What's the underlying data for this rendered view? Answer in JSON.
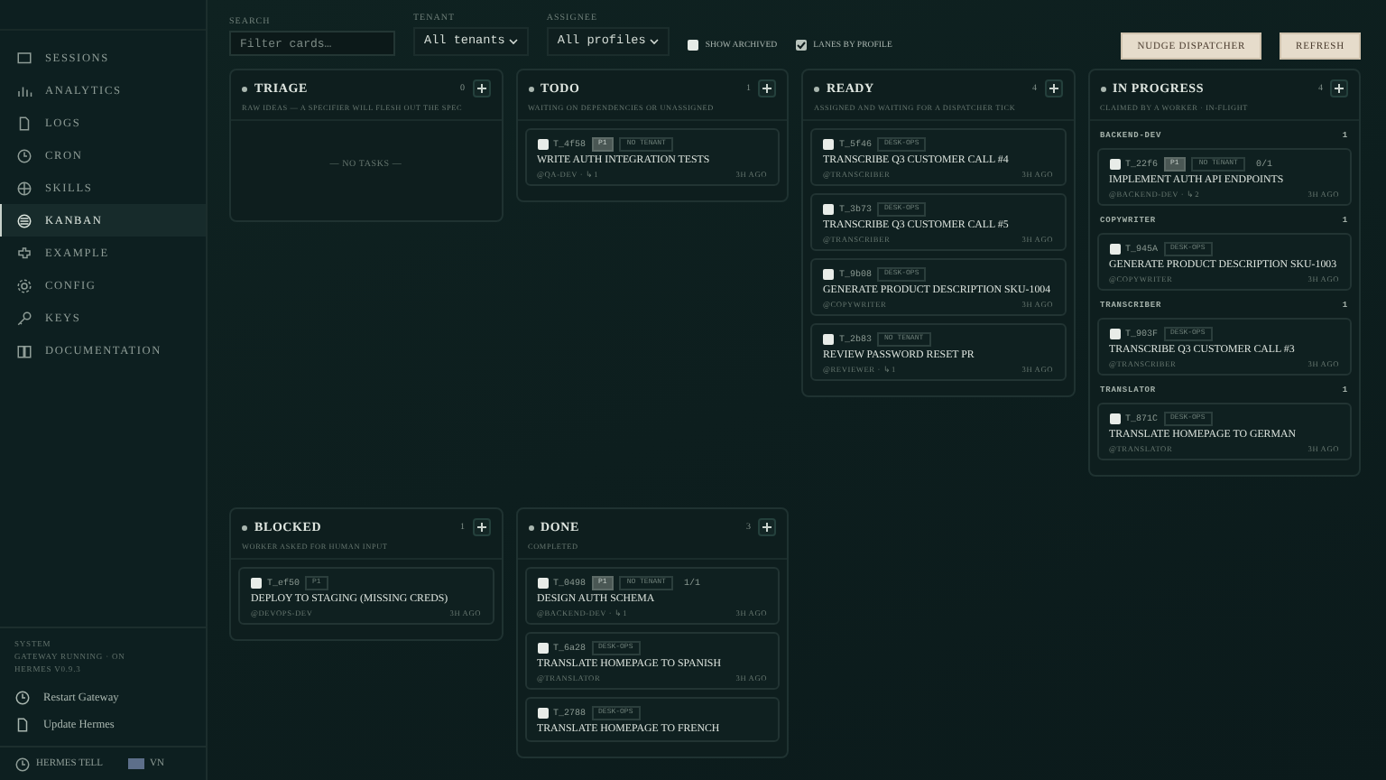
{
  "sidebar": {
    "items": [
      {
        "label": "SESSIONS",
        "selected": false
      },
      {
        "label": "ANALYTICS",
        "selected": false
      },
      {
        "label": "LOGS",
        "selected": false
      },
      {
        "label": "CRON",
        "selected": false
      },
      {
        "label": "SKILLS",
        "selected": false
      },
      {
        "label": "KANBAN",
        "selected": true
      },
      {
        "label": "EXAMPLE",
        "selected": false
      },
      {
        "label": "CONFIG",
        "selected": false
      },
      {
        "label": "KEYS",
        "selected": false
      },
      {
        "label": "DOCUMENTATION",
        "selected": false
      }
    ],
    "system": {
      "title": "SYSTEM",
      "lines": [
        "GATEWAY RUNNING · ON",
        "HERMES V0.9.3"
      ]
    },
    "actions": [
      "Restart Gateway",
      "Update Hermes"
    ],
    "footer": {
      "name": "HERMES TELL",
      "lang": "VN"
    }
  },
  "toolbar": {
    "search": {
      "label": "SEARCH",
      "placeholder": "Filter cards…"
    },
    "tenant": {
      "label": "TENANT",
      "value": "All tenants"
    },
    "assignee": {
      "label": "ASSIGNEE",
      "value": "All profiles"
    },
    "toggles": [
      {
        "label": "SHOW ARCHIVED",
        "checked": false
      },
      {
        "label": "LANES BY PROFILE",
        "checked": true
      }
    ],
    "buttons": [
      "NUDGE DISPATCHER",
      "REFRESH"
    ]
  },
  "columns": [
    {
      "title": "TRIAGE",
      "count": "0",
      "description": "RAW IDEAS — A SPECIFIER WILL FLESH OUT THE SPEC",
      "empty": "— NO TASKS —"
    },
    {
      "title": "TODO",
      "count": "1",
      "description": "WAITING ON DEPENDENCIES OR UNASSIGNED",
      "cards": [
        {
          "id": "T_4f58",
          "tags": [
            {
              "text": "P1",
              "kind": "priority"
            },
            {
              "text": "NO TENANT",
              "kind": "tenant"
            }
          ],
          "title": "WRITE AUTH INTEGRATION TESTS",
          "meta": "@QA-DEV · ↳ 1",
          "time": "3H AGO",
          "selected": false
        }
      ]
    },
    {
      "title": "READY",
      "count": "4",
      "description": "ASSIGNED AND WAITING FOR A DISPATCHER TICK",
      "cards": [
        {
          "id": "T_5f46",
          "tags": [
            {
              "text": "DESK-OPS",
              "kind": "tenant"
            }
          ],
          "title": "TRANSCRIBE Q3 CUSTOMER CALL #4",
          "meta": "@TRANSCRIBER",
          "time": "3H AGO",
          "selected": false
        },
        {
          "id": "T_3b73",
          "tags": [
            {
              "text": "DESK-OPS",
              "kind": "tenant"
            }
          ],
          "title": "TRANSCRIBE Q3 CUSTOMER CALL #5",
          "meta": "@TRANSCRIBER",
          "time": "3H AGO",
          "selected": false
        },
        {
          "id": "T_9b08",
          "tags": [
            {
              "text": "DESK-OPS",
              "kind": "tenant"
            }
          ],
          "title": "GENERATE PRODUCT DESCRIPTION SKU-1004",
          "meta": "@COPYWRITER",
          "time": "3H AGO",
          "selected": false
        },
        {
          "id": "T_2b83",
          "tags": [
            {
              "text": "NO TENANT",
              "kind": "tenant"
            }
          ],
          "title": "REVIEW PASSWORD RESET PR",
          "meta": "@REVIEWER · ↳ 1",
          "time": "3H AGO",
          "selected": false
        }
      ]
    },
    {
      "title": "IN PROGRESS",
      "count": "4",
      "description": "CLAIMED BY A WORKER · IN-FLIGHT",
      "lanes": [
        {
          "name": "BACKEND-DEV",
          "count": "1",
          "cards": [
            {
              "id": "T_22f6",
              "tags": [
                {
                  "text": "P1",
                  "kind": "priority"
                },
                {
                  "text": "NO TENANT",
                  "kind": "tenant"
                },
                {
                  "text": "0/1",
                  "kind": "progress"
                }
              ],
              "title": "IMPLEMENT AUTH API ENDPOINTS",
              "meta": "@BACKEND-DEV · ↳ 2",
              "time": "3H AGO",
              "selected": false
            }
          ]
        },
        {
          "name": "COPYWRITER",
          "count": "1",
          "cards": [
            {
              "id": "T_945A",
              "tags": [
                {
                  "text": "DESK-OPS",
                  "kind": "tenant"
                }
              ],
              "title": "GENERATE PRODUCT DESCRIPTION SKU-1003",
              "meta": "@COPYWRITER",
              "time": "3H AGO",
              "selected": false
            }
          ]
        },
        {
          "name": "TRANSCRIBER",
          "count": "1",
          "cards": [
            {
              "id": "T_903F",
              "tags": [
                {
                  "text": "DESK-OPS",
                  "kind": "tenant"
                }
              ],
              "title": "TRANSCRIBE Q3 CUSTOMER CALL #3",
              "meta": "@TRANSCRIBER",
              "time": "3H AGO",
              "selected": false
            }
          ]
        },
        {
          "name": "TRANSLATOR",
          "count": "1",
          "cards": [
            {
              "id": "T_871C",
              "tags": [
                {
                  "text": "DESK-OPS",
                  "kind": "tenant"
                }
              ],
              "title": "TRANSLATE HOMEPAGE TO GERMAN",
              "meta": "@TRANSLATOR",
              "time": "3H AGO",
              "selected": false
            }
          ]
        }
      ]
    },
    {
      "title": "BLOCKED",
      "count": "1",
      "description": "WORKER ASKED FOR HUMAN INPUT",
      "cards": [
        {
          "id": "T_ef50",
          "tags": [
            {
              "text": "P1",
              "kind": "tenant"
            }
          ],
          "title": "DEPLOY TO STAGING (MISSING CREDS)",
          "meta": "@DEVOPS-DEV",
          "time": "3H AGO",
          "selected": false
        }
      ]
    },
    {
      "title": "DONE",
      "count": "3",
      "description": "COMPLETED",
      "cards": [
        {
          "id": "T_0498",
          "tags": [
            {
              "text": "P1",
              "kind": "priority"
            },
            {
              "text": "NO TENANT",
              "kind": "tenant"
            },
            {
              "text": "1/1",
              "kind": "progress"
            }
          ],
          "title": "DESIGN AUTH SCHEMA",
          "meta": "@BACKEND-DEV · ↳ 1",
          "time": "3H AGO",
          "selected": false
        },
        {
          "id": "T_6a28",
          "tags": [
            {
              "text": "DESK-OPS",
              "kind": "tenant"
            }
          ],
          "title": "TRANSLATE HOMEPAGE TO SPANISH",
          "meta": "@TRANSLATOR",
          "time": "3H AGO",
          "selected": false
        },
        {
          "id": "T_2788",
          "tags": [
            {
              "text": "DESK-OPS",
              "kind": "tenant"
            }
          ],
          "title": "TRANSLATE HOMEPAGE TO FRENCH",
          "selected": false
        }
      ]
    }
  ]
}
